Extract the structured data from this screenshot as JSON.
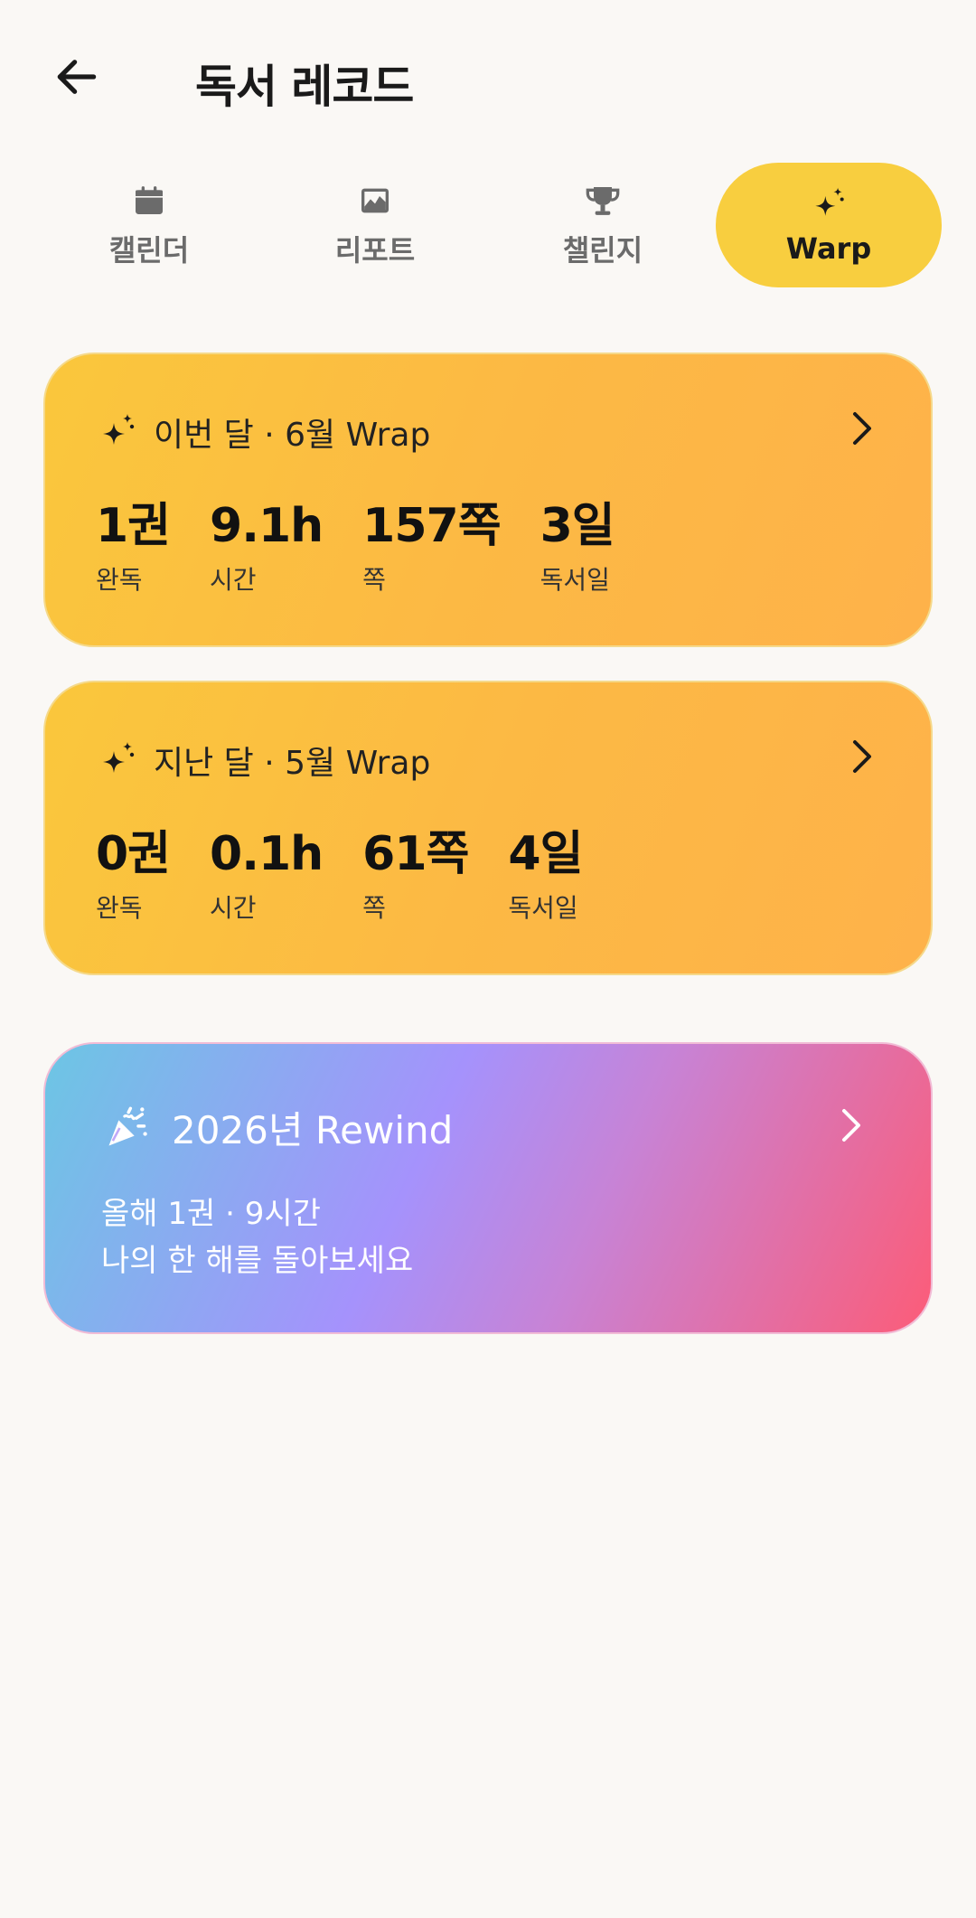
{
  "header": {
    "title": "독서 레코드",
    "back_icon": "arrow-left-icon"
  },
  "tabs": [
    {
      "label": "캘린더",
      "icon": "calendar-icon",
      "active": false
    },
    {
      "label": "리포트",
      "icon": "chart-image-icon",
      "active": false
    },
    {
      "label": "챌린지",
      "icon": "trophy-icon",
      "active": false
    },
    {
      "label": "Warp",
      "icon": "sparkle-icon",
      "active": true
    }
  ],
  "this_month": {
    "title": "이번 달 · 6월 Wrap",
    "stats": [
      {
        "value": "1권",
        "label": "완독"
      },
      {
        "value": "9.1h",
        "label": "시간"
      },
      {
        "value": "157쪽",
        "label": "쪽"
      },
      {
        "value": "3일",
        "label": "독서일"
      }
    ]
  },
  "last_month": {
    "title": "지난 달 · 5월 Wrap",
    "stats": [
      {
        "value": "0권",
        "label": "완독"
      },
      {
        "value": "0.1h",
        "label": "시간"
      },
      {
        "value": "61쪽",
        "label": "쪽"
      },
      {
        "value": "4일",
        "label": "독서일"
      }
    ]
  },
  "rewind": {
    "title": "2026년 Rewind",
    "line1": "올해 1권 · 9시간",
    "line2": "나의 한 해를 돌아보세요"
  },
  "colors": {
    "background": "#faf8f5",
    "accent_yellow": "#f8ce3f",
    "wrap_gradient_start": "#fac73c",
    "wrap_gradient_end": "#feb24a",
    "rewind_gradient_start": "#6cc6e4",
    "rewind_gradient_mid": "#a592fc",
    "rewind_gradient_end": "#fc5c78"
  }
}
